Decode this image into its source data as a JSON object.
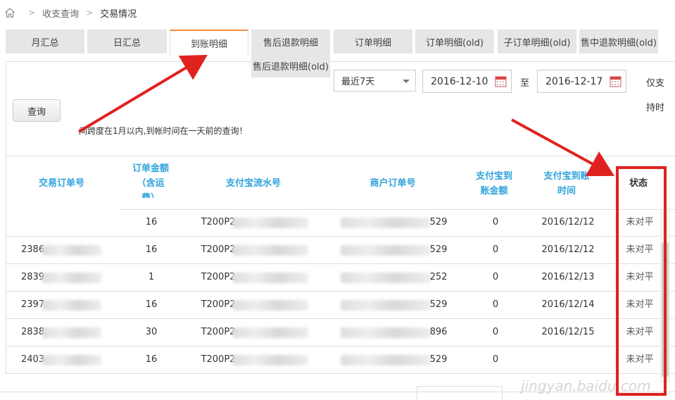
{
  "breadcrumb": {
    "level1": "收支查询",
    "current": "交易情况"
  },
  "tabs": [
    {
      "label": "月汇总"
    },
    {
      "label": "日汇总"
    },
    {
      "label": "到账明细"
    },
    {
      "label": "售后退款明细"
    },
    {
      "label": "订单明细"
    },
    {
      "label": "订单明细(old)"
    },
    {
      "label": "子订单明细(old)"
    },
    {
      "label": "售中退款明细(old)"
    }
  ],
  "tab_sub": "售后退款明细(old)",
  "filters": {
    "range_select": "最近7天",
    "start_date": "2016-12-10",
    "to_label": "至",
    "end_date": "2016-12-17",
    "support_line1": "仅支",
    "support_line2": "持时",
    "query_button": "查询",
    "notice": "间跨度在1月以内,到帐时间在一天前的查询！"
  },
  "table": {
    "headers": {
      "trade_order": "交易订单号",
      "order_amount_1": "订单金额",
      "order_amount_2": "（含运",
      "order_amount_3": "费）",
      "alipay_serial": "支付宝流水号",
      "merchant_order": "商户订单号",
      "received_amount_1": "支付宝到",
      "received_amount_2": "账金额",
      "received_time_1": "支付宝到账",
      "received_time_2": "时间",
      "status": "状态"
    },
    "rows": [
      {
        "order": "",
        "amount": "16",
        "serial": "T200P2",
        "merchant": "529",
        "received": "0",
        "time": "2016/12/12",
        "status": "未对平"
      },
      {
        "order": "2386",
        "amount": "16",
        "serial": "T200P2",
        "merchant": "529",
        "received": "0",
        "time": "2016/12/12",
        "status": "未对平"
      },
      {
        "order": "2839",
        "amount": "1",
        "serial": "T200P2",
        "merchant": "252",
        "received": "0",
        "time": "2016/12/13",
        "status": "未对平"
      },
      {
        "order": "2397",
        "amount": "16",
        "serial": "T200P2",
        "merchant": "529",
        "received": "0",
        "time": "2016/12/14",
        "status": "未对平"
      },
      {
        "order": "2838",
        "amount": "30",
        "serial": "T200P2",
        "merchant": "896",
        "received": "0",
        "time": "2016/12/15",
        "status": "未对平"
      },
      {
        "order": "2403",
        "amount": "16",
        "serial": "T200P2",
        "merchant": "529",
        "received": "0",
        "time": "",
        "status": "未对平"
      }
    ]
  },
  "watermark": "jingyan.baidu.com",
  "colors": {
    "tab_active_border": "#f08a3c",
    "header_blue": "#2ea3dc",
    "annotation_red": "#e0221e"
  }
}
